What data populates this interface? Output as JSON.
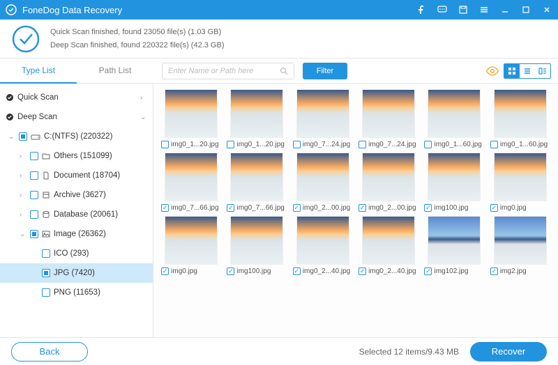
{
  "app": {
    "title": "FoneDog Data Recovery"
  },
  "status": {
    "quick": "Quick Scan finished, found 23050 file(s) (1.03 GB)",
    "deep": "Deep Scan finished, found 220322 file(s) (42.3 GB)"
  },
  "tabs": {
    "type": "Type List",
    "path": "Path List"
  },
  "search": {
    "placeholder": "Enter Name or Path here"
  },
  "filter": {
    "label": "Filter"
  },
  "tree": {
    "quickscan": "Quick Scan",
    "deepscan": "Deep Scan",
    "drive": "C:(NTFS) (220322)",
    "others": "Others (151099)",
    "document": "Document (18704)",
    "archive": "Archive (3627)",
    "database": "Database (20061)",
    "image": "Image (26362)",
    "ico": "ICO (293)",
    "jpg": "JPG (7420)",
    "png": "PNG (11653)"
  },
  "files": [
    {
      "name": "img0_1...20.jpg",
      "checked": false,
      "style": "a"
    },
    {
      "name": "img0_1...20.jpg",
      "checked": false,
      "style": "a"
    },
    {
      "name": "img0_7...24.jpg",
      "checked": false,
      "style": "a"
    },
    {
      "name": "img0_7...24.jpg",
      "checked": false,
      "style": "a"
    },
    {
      "name": "img0_1...60.jpg",
      "checked": false,
      "style": "a"
    },
    {
      "name": "img0_1...60.jpg",
      "checked": false,
      "style": "a"
    },
    {
      "name": "img0_7...66.jpg",
      "checked": true,
      "style": "a"
    },
    {
      "name": "img0_7...66.jpg",
      "checked": true,
      "style": "a"
    },
    {
      "name": "img0_2...00.jpg",
      "checked": true,
      "style": "a"
    },
    {
      "name": "img0_2...00.jpg",
      "checked": true,
      "style": "a"
    },
    {
      "name": "img100.jpg",
      "checked": true,
      "style": "a"
    },
    {
      "name": "img0.jpg",
      "checked": true,
      "style": "a"
    },
    {
      "name": "img0.jpg",
      "checked": true,
      "style": "a"
    },
    {
      "name": "img100.jpg",
      "checked": true,
      "style": "a"
    },
    {
      "name": "img0_2...40.jpg",
      "checked": true,
      "style": "a"
    },
    {
      "name": "img0_2...40.jpg",
      "checked": true,
      "style": "a"
    },
    {
      "name": "img102.jpg",
      "checked": true,
      "style": "b"
    },
    {
      "name": "img2.jpg",
      "checked": true,
      "style": "b"
    }
  ],
  "footer": {
    "back": "Back",
    "recover": "Recover",
    "selection": "Selected 12 items/9.43 MB"
  }
}
